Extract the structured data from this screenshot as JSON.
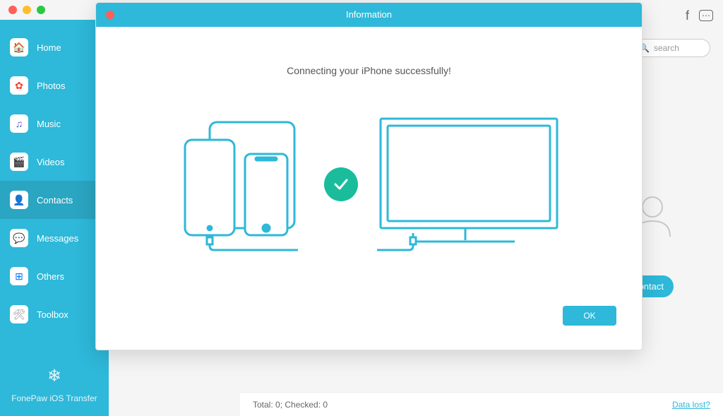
{
  "sidebar": {
    "items": [
      {
        "label": "Home",
        "icon": "🏠",
        "icon_color": "#ff9500",
        "name": "home"
      },
      {
        "label": "Photos",
        "icon": "✿",
        "icon_color": "#ff3b30",
        "name": "photos"
      },
      {
        "label": "Music",
        "icon": "♫",
        "icon_color": "#5856d6",
        "name": "music"
      },
      {
        "label": "Videos",
        "icon": "🎬",
        "icon_color": "#333",
        "name": "videos"
      },
      {
        "label": "Contacts",
        "icon": "👤",
        "icon_color": "#8e8e93",
        "name": "contacts",
        "active": true
      },
      {
        "label": "Messages",
        "icon": "💬",
        "icon_color": "#4cd964",
        "name": "messages"
      },
      {
        "label": "Others",
        "icon": "⊞",
        "icon_color": "#007aff",
        "name": "others"
      },
      {
        "label": "Toolbox",
        "icon": "🛠",
        "icon_color": "#8e8e93",
        "name": "toolbox"
      }
    ],
    "footer": "FonePaw iOS Transfer"
  },
  "search": {
    "placeholder": "search"
  },
  "contact_button": "Contact",
  "status": {
    "text": "Total: 0; Checked: 0",
    "link": "Data lost?"
  },
  "modal": {
    "title": "Information",
    "message": "Connecting your iPhone successfully!",
    "ok": "OK"
  }
}
